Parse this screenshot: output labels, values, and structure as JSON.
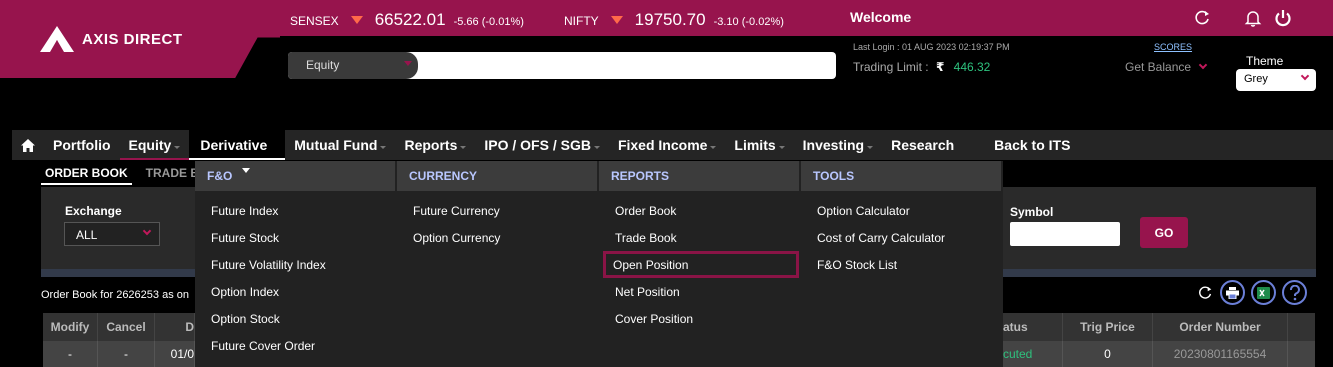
{
  "brand": {
    "logo_text": "AXIS DIRECT"
  },
  "ticker": [
    {
      "name": "SENSEX",
      "value": "66522.01",
      "change": "-5.66 (-0.01%)"
    },
    {
      "name": "NIFTY",
      "value": "19750.70",
      "change": "-3.10 (-0.02%)"
    }
  ],
  "header": {
    "welcome": "Welcome",
    "last_login": "Last Login : 01 AUG 2023 02:19:37 PM",
    "trading_limit_label": "Trading Limit :",
    "trading_limit_currency": "₹",
    "trading_limit_value": "446.32",
    "scores_link": "SCORES",
    "get_balance": "Get Balance",
    "theme_label": "Theme",
    "theme_value": "Grey"
  },
  "search": {
    "segment": "Equity"
  },
  "nav": {
    "items": [
      {
        "label": "Portfolio"
      },
      {
        "label": "Equity"
      },
      {
        "label": "Derivative"
      },
      {
        "label": "Mutual Fund"
      },
      {
        "label": "Reports"
      },
      {
        "label": "IPO / OFS / SGB"
      },
      {
        "label": "Fixed Income"
      },
      {
        "label": "Limits"
      },
      {
        "label": "Investing"
      },
      {
        "label": "Research"
      },
      {
        "label": "Back to ITS"
      }
    ]
  },
  "subtabs": [
    "ORDER BOOK",
    "TRADE BO"
  ],
  "filters": {
    "exchange_label": "Exchange",
    "exchange_value": "ALL",
    "symbol_label": "Symbol",
    "go_label": "GO"
  },
  "order_book": {
    "caption": "Order Book for 2626253 as on",
    "columns": [
      "Modify",
      "Cancel",
      "D",
      "atus",
      "Trig Price",
      "Order Number"
    ],
    "row": [
      "-",
      "-",
      "01/0",
      "cuted",
      "0",
      "20230801165554"
    ]
  },
  "mega_menu": {
    "columns": [
      {
        "heading": "F&O",
        "items": [
          "Future Index",
          "Future Stock",
          "Future Volatility Index",
          "Option Index",
          "Option Stock",
          "Future Cover Order"
        ]
      },
      {
        "heading": "CURRENCY",
        "items": [
          "Future Currency",
          "Option Currency"
        ]
      },
      {
        "heading": "REPORTS",
        "items": [
          "Order Book",
          "Trade Book",
          "Open Position",
          "Net Position",
          "Cover Position"
        ]
      },
      {
        "heading": "TOOLS",
        "items": [
          "Option Calculator",
          "Cost of Carry Calculator",
          "F&O Stock List"
        ]
      }
    ]
  },
  "colors": {
    "brand": "#97144d",
    "down": "#ff6a4a",
    "positive": "#2ec27e",
    "menu_heading": "#b9c7ff"
  }
}
